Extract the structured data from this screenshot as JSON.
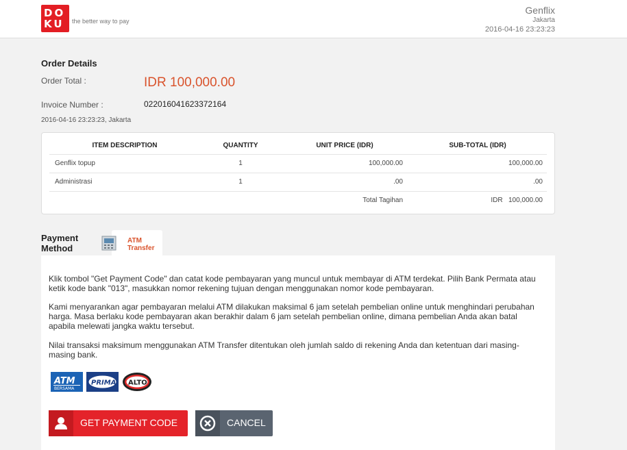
{
  "header": {
    "logo_line1": "DO",
    "logo_line2": "KU",
    "tagline": "the better way to pay",
    "merchant_name": "Genflix",
    "merchant_city": "Jakarta",
    "datetime": "2016-04-16 23:23:23"
  },
  "order": {
    "title": "Order Details",
    "total_label": "Order Total :",
    "total_value": "IDR 100,000.00",
    "invoice_label": "Invoice Number :",
    "invoice_value": "022016041623372164",
    "date_city": "2016-04-16 23:23:23, Jakarta",
    "table": {
      "headers": [
        "ITEM DESCRIPTION",
        "QUANTITY",
        "UNIT PRICE (IDR)",
        "SUB-TOTAL (IDR)"
      ],
      "rows": [
        {
          "desc": "Genflix topup",
          "qty": "1",
          "unit": "100,000.00",
          "sub": "100,000.00"
        },
        {
          "desc": "Administrasi",
          "qty": "1",
          "unit": ".00",
          "sub": ".00"
        }
      ],
      "total_label": "Total Tagihan",
      "total_value": "IDR   100,000.00"
    }
  },
  "payment": {
    "label_line1": "Payment",
    "label_line2": "Method",
    "tab_line1": "ATM",
    "tab_line2": "Transfer",
    "paragraph1": "Klik tombol \"Get Payment Code\" dan catat kode pembayaran yang muncul untuk membayar di ATM terdekat. Pilih Bank Permata atau ketik kode bank \"013\", masukkan nomor rekening tujuan dengan menggunakan nomor kode pembayaran.",
    "paragraph2": "Kami menyarankan agar pembayaran melalui ATM dilakukan maksimal 6 jam setelah pembelian online untuk menghindari perubahan harga. Masa berlaku kode pembayaran akan berakhir dalam 6 jam setelah pembelian online, dimana pembelian Anda akan batal apabila melewati jangka waktu tersebut.",
    "paragraph3": "Nilai transaksi maksimum menggunakan ATM Transfer ditentukan oleh jumlah saldo di rekening Anda dan ketentuan dari masing-masing bank.",
    "banks": {
      "atm_bersama": "ATM",
      "atm_bersama_sub": "BERSAMA",
      "prima": "PRIMA",
      "alto": "ALTO"
    },
    "get_code_label": "GET PAYMENT CODE",
    "cancel_label": "CANCEL"
  },
  "colors": {
    "accent": "#d9532c",
    "brand_red": "#e31e24",
    "cancel_gray": "#5a6470"
  }
}
